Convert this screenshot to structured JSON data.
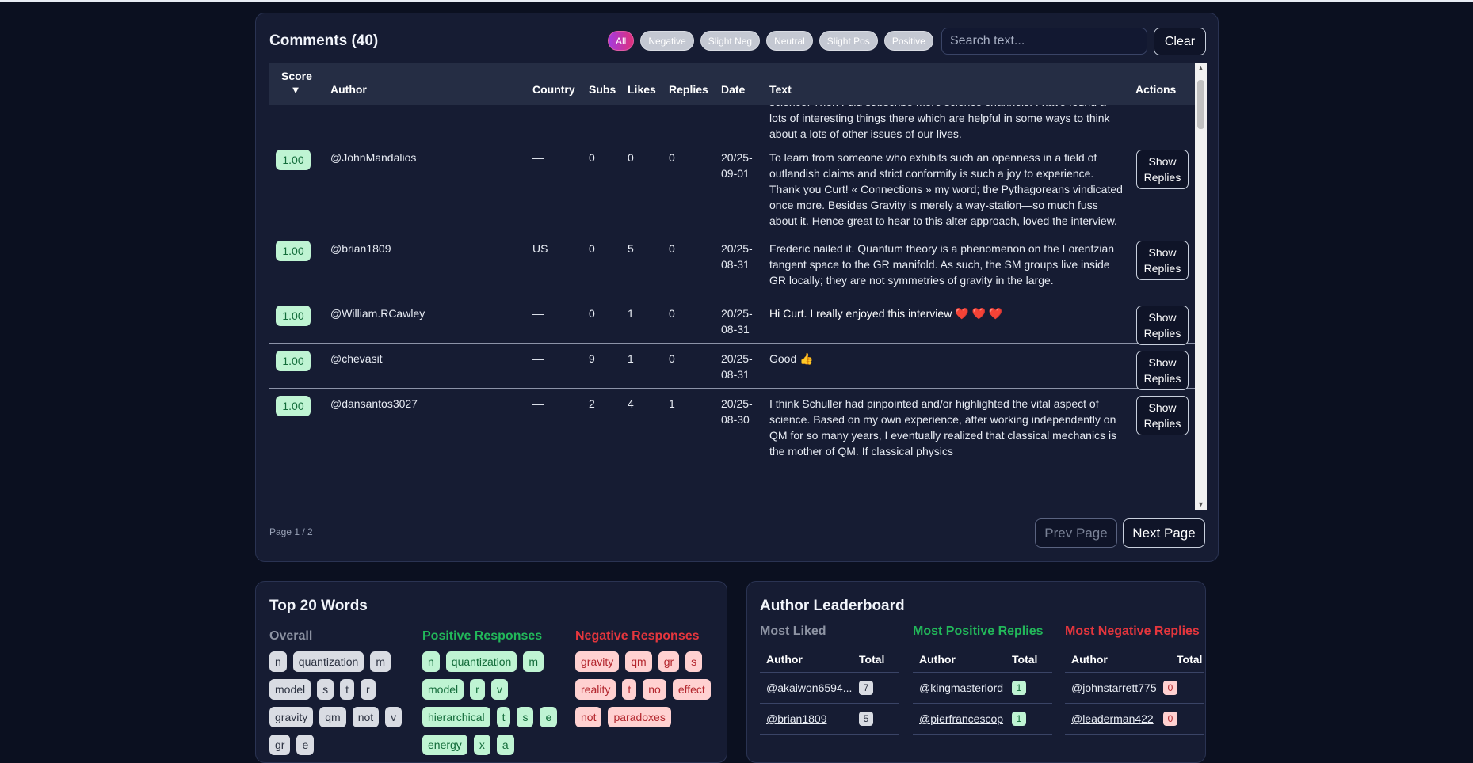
{
  "comments": {
    "title": "Comments (40)",
    "filters": [
      "All",
      "Negative",
      "Slight Neg",
      "Neutral",
      "Slight Pos",
      "Positive"
    ],
    "search_placeholder": "Search text...",
    "clear_label": "Clear",
    "columns": {
      "score": "Score",
      "sort_arrow": "▼",
      "author": "Author",
      "country": "Country",
      "subs": "Subs",
      "likes": "Likes",
      "replies": "Replies",
      "date": "Date",
      "text": "Text",
      "actions": "Actions"
    },
    "partial_row_text": "science. Then I did subscribe more science channels. I have found a lots of interesting things there which are helpful in some ways to think about a lots of other issues of our lives.",
    "rows": [
      {
        "score": "1.00",
        "author": "@JohnMandalios",
        "country": "—",
        "subs": "0",
        "likes": "0",
        "replies": "0",
        "date": "20/25-09-01",
        "text": "To learn from someone who exhibits such an openness in a field of outlandish claims and strict conformity is such a joy to experience. Thank you Curt! « Connections » my word; the Pythagoreans vindicated once more. Besides Gravity is merely a way-station—so much fuss about it. Hence great to hear to this alter approach, loved the interview.",
        "action": "Show Replies"
      },
      {
        "score": "1.00",
        "author": "@brian1809",
        "country": "US",
        "subs": "0",
        "likes": "5",
        "replies": "0",
        "date": "20/25-08-31",
        "text": "Frederic nailed it. Quantum theory is a phenomenon on the Lorentzian tangent space to the GR manifold. As such, the SM groups live inside GR locally; they are not symmetries of gravity in the large.",
        "action": "Show Replies"
      },
      {
        "score": "1.00",
        "author": "@William.RCawley",
        "country": "—",
        "subs": "0",
        "likes": "1",
        "replies": "0",
        "date": "20/25-08-31",
        "text": "Hi Curt. I really enjoyed this interview ❤️ ❤️ ❤️",
        "action": "Show Replies"
      },
      {
        "score": "1.00",
        "author": "@chevasit",
        "country": "—",
        "subs": "9",
        "likes": "1",
        "replies": "0",
        "date": "20/25-08-31",
        "text": "Good 👍",
        "action": "Show Replies"
      },
      {
        "score": "1.00",
        "author": "@dansantos3027",
        "country": "—",
        "subs": "2",
        "likes": "4",
        "replies": "1",
        "date": "20/25-08-30",
        "text": "I think Schuller had pinpointed and/or highlighted the vital aspect of science. Based on my own experience, after working independently on QM for so many years, I eventually realized that classical mechanics is the mother of QM. If classical physics",
        "action": "Show Replies"
      }
    ],
    "page_indicator": "Page 1 / 2",
    "prev_label": "Prev Page",
    "next_label": "Next Page"
  },
  "words": {
    "title": "Top 20 Words",
    "overall_label": "Overall",
    "positive_label": "Positive Responses",
    "negative_label": "Negative Responses",
    "overall": [
      "n",
      "quantization",
      "m",
      "model",
      "s",
      "t",
      "r",
      "gravity",
      "qm",
      "not",
      "v",
      "gr",
      "e"
    ],
    "positive": [
      "n",
      "quantization",
      "m",
      "model",
      "r",
      "v",
      "hierarchical",
      "t",
      "s",
      "e",
      "energy",
      "x",
      "a"
    ],
    "negative": [
      "gravity",
      "qm",
      "gr",
      "s",
      "reality",
      "t",
      "no",
      "effect",
      "not",
      "paradoxes"
    ]
  },
  "leaderboard": {
    "title": "Author Leaderboard",
    "most_liked_label": "Most Liked",
    "most_positive_label": "Most Positive Replies",
    "most_negative_label": "Most Negative Replies",
    "author_col": "Author",
    "total_col": "Total",
    "most_liked": [
      {
        "name": "@akaiwon6594...",
        "total": "7"
      },
      {
        "name": "@brian1809",
        "total": "5"
      }
    ],
    "most_positive": [
      {
        "name": "@kingmasterlord",
        "total": "1"
      },
      {
        "name": "@pierfrancescop",
        "total": "1"
      }
    ],
    "most_negative": [
      {
        "name": "@johnstarrett775",
        "total": "0"
      },
      {
        "name": "@leaderman422",
        "total": "0"
      }
    ]
  },
  "colors": {
    "background": "#0b1020",
    "panel": "#161c33",
    "positive": "#22b85a",
    "negative": "#e5363d",
    "accent": "#c13bb0"
  }
}
